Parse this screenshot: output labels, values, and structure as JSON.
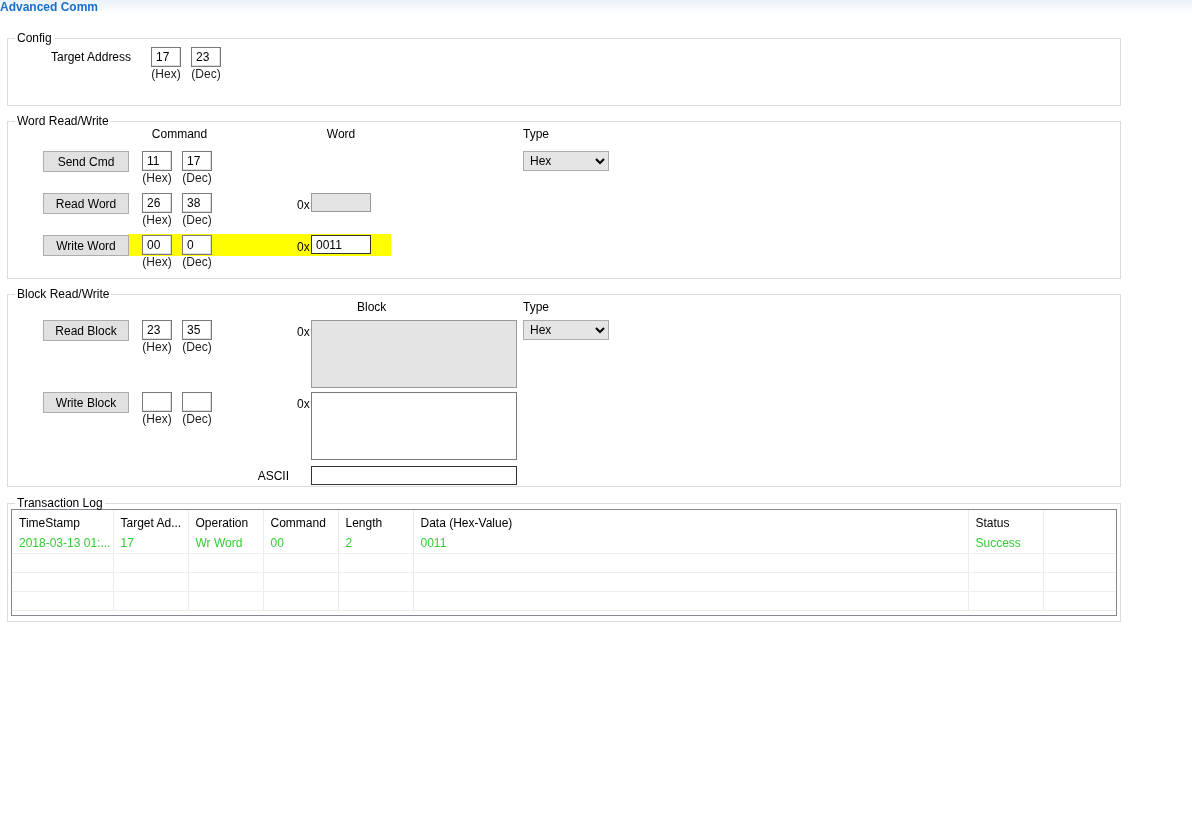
{
  "window": {
    "title": "Advanced Comm"
  },
  "config": {
    "legend": "Config",
    "label": "Target Address",
    "hex": "17",
    "hex_label": "(Hex)",
    "dec": "23",
    "dec_label": "(Dec)"
  },
  "word": {
    "legend": "Word Read/Write",
    "command_heading": "Command",
    "word_heading": "Word",
    "type_heading": "Type",
    "type_value": "Hex",
    "rows": [
      {
        "button": "Send Cmd",
        "hex": "11",
        "hex_label": "(Hex)",
        "dec": "17",
        "dec_label": "(Dec)",
        "highlighted": false
      },
      {
        "button": "Read Word",
        "hex": "26",
        "hex_label": "(Hex)",
        "dec": "38",
        "dec_label": "(Dec)",
        "prefix": "0x",
        "value": "",
        "readonly": true,
        "highlighted": false
      },
      {
        "button": "Write Word",
        "hex": "00",
        "hex_label": "(Hex)",
        "dec": "0",
        "dec_label": "(Dec)",
        "prefix": "0x",
        "value": "0011",
        "readonly": false,
        "highlighted": true
      }
    ]
  },
  "block": {
    "legend": "Block Read/Write",
    "block_heading": "Block",
    "type_heading": "Type",
    "type_value": "Hex",
    "rows": [
      {
        "button": "Read Block",
        "hex": "23",
        "hex_label": "(Hex)",
        "dec": "35",
        "dec_label": "(Dec)",
        "prefix": "0x",
        "readonly": true
      },
      {
        "button": "Write Block",
        "hex": "",
        "hex_label": "(Hex)",
        "dec": "",
        "dec_label": "(Dec)",
        "prefix": "0x",
        "readonly": false
      }
    ],
    "ascii_label": "ASCII"
  },
  "log": {
    "legend": "Transaction Log",
    "columns": [
      "TimeStamp",
      "Target Ad...",
      "Operation",
      "Command",
      "Length",
      "Data (Hex-Value)",
      "Status"
    ],
    "rows": [
      {
        "cells": [
          "2018-03-13 01:...",
          "17",
          "Wr Word",
          "00",
          "2",
          "0011",
          "Success"
        ]
      }
    ]
  }
}
